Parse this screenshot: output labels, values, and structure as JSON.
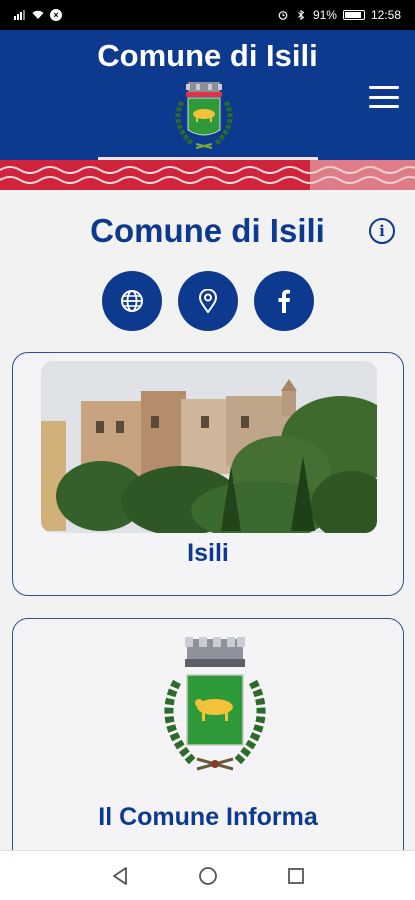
{
  "status_bar": {
    "time": "12:58",
    "battery_text": "91%",
    "battery_level": 0.91,
    "icons": [
      "signal-icon",
      "wifi-icon",
      "cancel-circle-icon",
      "alarm-icon",
      "bluetooth-icon",
      "battery-icon"
    ]
  },
  "header": {
    "title": "Comune di Isili",
    "menu_icon": "hamburger-menu-icon",
    "crest_icon": "coat-of-arms-icon",
    "colors": {
      "background": "#0d3a8e",
      "wave_red": "#d0233c"
    }
  },
  "main": {
    "title": "Comune di Isili",
    "info_icon": "info-icon",
    "info_glyph": "i",
    "social": [
      {
        "name": "website",
        "icon": "globe-icon"
      },
      {
        "name": "location",
        "icon": "map-pin-icon"
      },
      {
        "name": "facebook",
        "icon": "facebook-icon"
      }
    ],
    "cards": [
      {
        "label": "Isili",
        "image": "town-photo"
      },
      {
        "label": "Il Comune Informa",
        "image": "coat-of-arms"
      }
    ]
  },
  "nav_bar": {
    "buttons": [
      "back-icon",
      "home-icon",
      "recents-icon"
    ]
  }
}
